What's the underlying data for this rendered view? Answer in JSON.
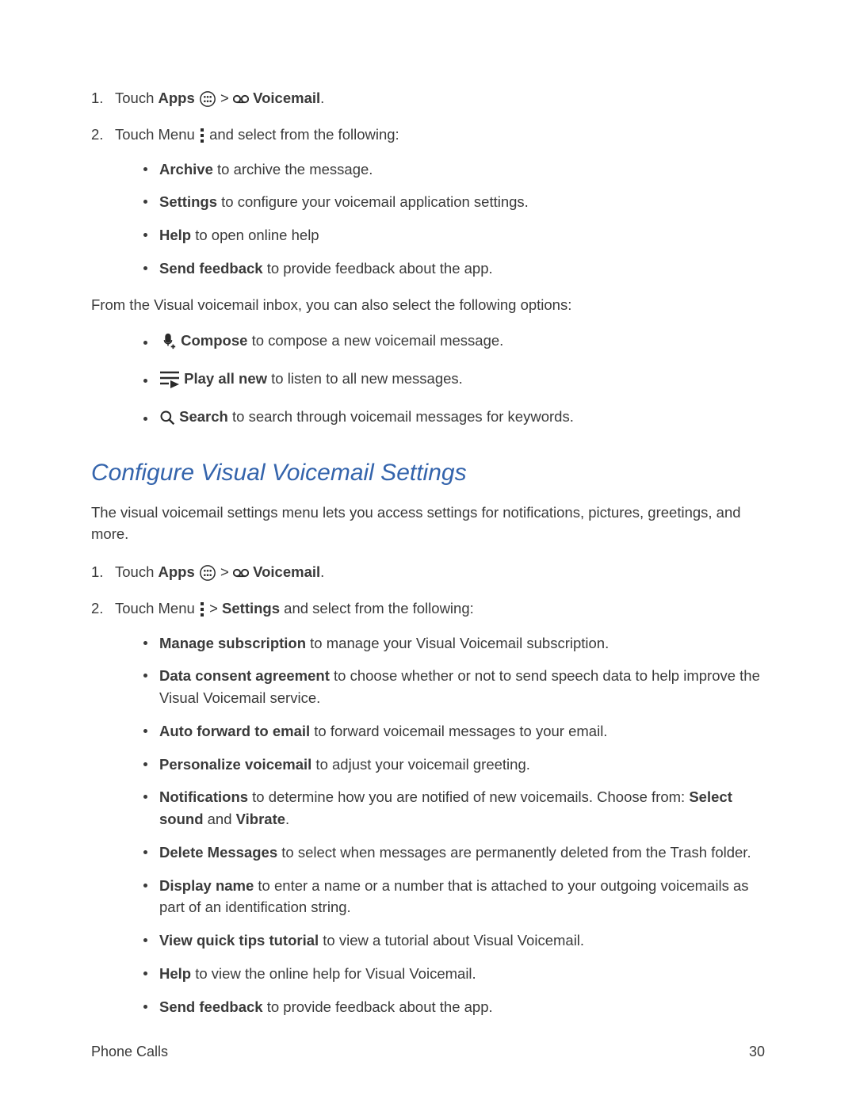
{
  "steps1": {
    "step1": {
      "num": "1.",
      "touch": "Touch ",
      "apps": "Apps",
      "gt": " > ",
      "voicemail": "Voicemail",
      "period": "."
    },
    "step2": {
      "num": "2.",
      "touch": "Touch Menu",
      "rest": "and select from the following:",
      "items": [
        {
          "bold": "Archive",
          "rest": " to archive the message."
        },
        {
          "bold": "Settings",
          "rest": " to configure your voicemail application settings."
        },
        {
          "bold": "Help",
          "rest": " to open online help"
        },
        {
          "bold": "Send feedback",
          "rest": " to provide feedback about the app."
        }
      ]
    }
  },
  "inbox_para": "From the Visual voicemail inbox, you can also select the following options:",
  "inbox_options": [
    {
      "bold": "Compose",
      "rest": " to compose a new voicemail message."
    },
    {
      "bold": "Play all new",
      "rest": " to listen to all new messages."
    },
    {
      "bold": "Search",
      "rest": " to search through voicemail messages for keywords."
    }
  ],
  "section_title": "Configure Visual Voicemail Settings",
  "section_intro": "The visual voicemail settings menu lets you access settings for notifications, pictures, greetings, and more.",
  "steps2": {
    "step1": {
      "num": "1.",
      "touch": "Touch ",
      "apps": "Apps",
      "gt": " > ",
      "voicemail": "Voicemail",
      "period": "."
    },
    "step2": {
      "num": "2.",
      "touch": "Touch Menu",
      "gt": " > ",
      "settings": "Settings",
      "rest": " and select from the following:",
      "items": [
        {
          "bold": "Manage subscription",
          "rest": " to manage your Visual Voicemail subscription."
        },
        {
          "bold": "Data consent agreement",
          "rest": " to choose whether or not to send speech data to help improve the Visual Voicemail service."
        },
        {
          "bold": "Auto forward to email",
          "rest": " to forward voicemail messages to your email."
        },
        {
          "bold": "Personalize voicemail",
          "rest": " to adjust your voicemail greeting."
        },
        {
          "bold_start": "Notifications",
          "mid": " to determine how you are notified of new voicemails. Choose from: ",
          "bold2": "Select sound",
          "and": " and ",
          "bold3": "Vibrate",
          "period": "."
        },
        {
          "bold": "Delete Messages",
          "rest": " to select when messages are permanently deleted from the Trash folder."
        },
        {
          "bold": "Display name",
          "rest": " to enter a name or a number that is attached to your outgoing voicemails as part of an identification string."
        },
        {
          "bold": "View quick tips tutorial",
          "rest": " to view a tutorial about Visual Voicemail."
        },
        {
          "bold": "Help",
          "rest": " to view the online help for Visual Voicemail."
        },
        {
          "bold": "Send feedback",
          "rest": " to provide feedback about the app."
        }
      ]
    }
  },
  "footer": {
    "left": "Phone Calls",
    "right": "30"
  }
}
